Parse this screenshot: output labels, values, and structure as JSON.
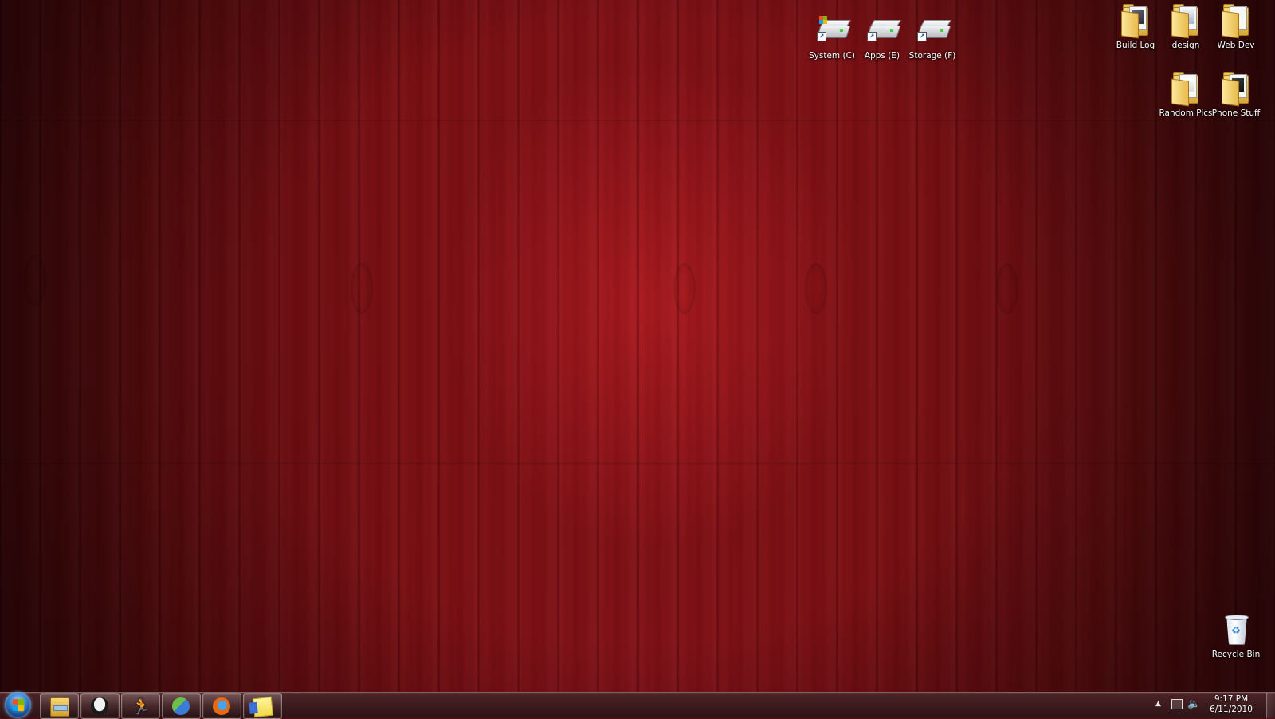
{
  "desktop": {
    "icons": [
      {
        "label": "System (C)",
        "icon": "drive-system-icon"
      },
      {
        "label": "Apps (E)",
        "icon": "drive-icon"
      },
      {
        "label": "Storage (F)",
        "icon": "drive-icon"
      },
      {
        "label": "Build Log",
        "icon": "folder-icon"
      },
      {
        "label": "design",
        "icon": "folder-icon"
      },
      {
        "label": "Web Dev",
        "icon": "folder-icon"
      },
      {
        "label": "Random Pics",
        "icon": "folder-icon"
      },
      {
        "label": "Phone Stuff",
        "icon": "folder-icon"
      },
      {
        "label": "Recycle Bin",
        "icon": "recycle-bin-icon"
      }
    ]
  },
  "taskbar": {
    "start_button": "windows-start-orb-icon",
    "pinned": [
      {
        "app": "windows-explorer-icon"
      },
      {
        "app": "alienware-alien-icon"
      },
      {
        "app": "aim-running-man-icon"
      },
      {
        "app": "windows-live-messenger-icon"
      },
      {
        "app": "firefox-icon"
      },
      {
        "app": "sticky-notes-icon"
      }
    ],
    "tray": {
      "icons": [
        "show-hidden-icons-chevron-icon",
        "network-icon",
        "volume-icon"
      ],
      "time": "9:17 PM",
      "date": "6/11/2010"
    }
  },
  "colors": {
    "wallpaper": "#86121a",
    "taskbar": "#3a1e20"
  }
}
